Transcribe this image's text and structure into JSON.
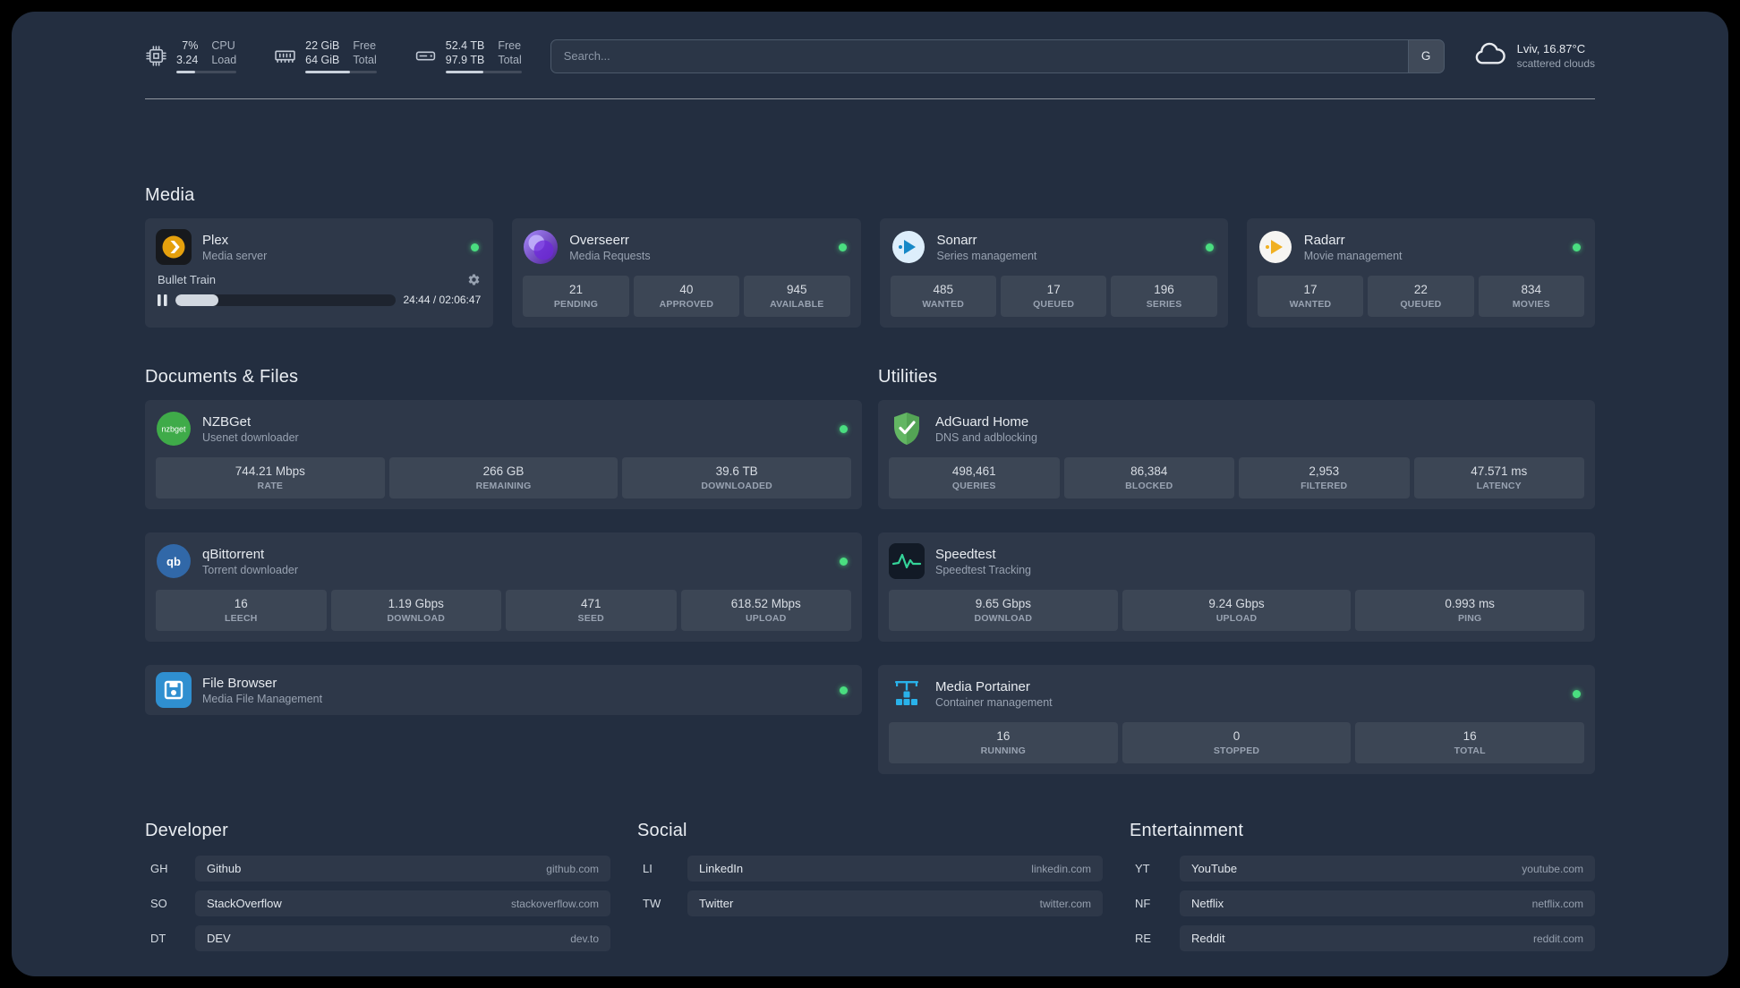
{
  "theme": {
    "background": "#232e40",
    "card": "rgba(255,255,255,0.05)",
    "status_dot_green": "#4ade80",
    "speedtest_line_green": "#34d399",
    "plex_amber": "#e5a00d"
  },
  "topbar": {
    "cpu": {
      "v1": "7%",
      "l1": "CPU",
      "v2": "3.24",
      "l2": "Load",
      "bar_pct": 32
    },
    "memory": {
      "v1": "22 GiB",
      "l1": "Free",
      "v2": "64 GiB",
      "l2": "Total",
      "bar_pct": 62
    },
    "disk": {
      "v1": "52.4 TB",
      "l1": "Free",
      "v2": "97.9 TB",
      "l2": "Total",
      "bar_pct": 50
    },
    "search": {
      "placeholder": "Search...",
      "button": "G"
    },
    "weather": {
      "location": "Lviv, 16.87°C",
      "condition": "scattered clouds"
    }
  },
  "sections": {
    "media": {
      "title": "Media",
      "plex": {
        "name": "Plex",
        "desc": "Media server",
        "now_playing": "Bullet Train",
        "time": "24:44 / 02:06:47",
        "progress_pct": 19.5
      },
      "overseerr": {
        "name": "Overseerr",
        "desc": "Media Requests",
        "stats": [
          {
            "v": "21",
            "l": "PENDING"
          },
          {
            "v": "40",
            "l": "APPROVED"
          },
          {
            "v": "945",
            "l": "AVAILABLE"
          }
        ]
      },
      "sonarr": {
        "name": "Sonarr",
        "desc": "Series management",
        "stats": [
          {
            "v": "485",
            "l": "WANTED"
          },
          {
            "v": "17",
            "l": "QUEUED"
          },
          {
            "v": "196",
            "l": "SERIES"
          }
        ]
      },
      "radarr": {
        "name": "Radarr",
        "desc": "Movie management",
        "stats": [
          {
            "v": "17",
            "l": "WANTED"
          },
          {
            "v": "22",
            "l": "QUEUED"
          },
          {
            "v": "834",
            "l": "MOVIES"
          }
        ]
      }
    },
    "documents": {
      "title": "Documents & Files",
      "nzbget": {
        "name": "NZBGet",
        "desc": "Usenet downloader",
        "stats": [
          {
            "v": "744.21 Mbps",
            "l": "RATE"
          },
          {
            "v": "266 GB",
            "l": "REMAINING"
          },
          {
            "v": "39.6 TB",
            "l": "DOWNLOADED"
          }
        ]
      },
      "qbittorrent": {
        "name": "qBittorrent",
        "desc": "Torrent downloader",
        "stats": [
          {
            "v": "16",
            "l": "LEECH"
          },
          {
            "v": "1.19 Gbps",
            "l": "DOWNLOAD"
          },
          {
            "v": "471",
            "l": "SEED"
          },
          {
            "v": "618.52 Mbps",
            "l": "UPLOAD"
          }
        ]
      },
      "filebrowser": {
        "name": "File Browser",
        "desc": "Media File Management"
      }
    },
    "utilities": {
      "title": "Utilities",
      "adguard": {
        "name": "AdGuard Home",
        "desc": "DNS and adblocking",
        "stats": [
          {
            "v": "498,461",
            "l": "QUERIES"
          },
          {
            "v": "86,384",
            "l": "BLOCKED"
          },
          {
            "v": "2,953",
            "l": "FILTERED"
          },
          {
            "v": "47.571 ms",
            "l": "LATENCY"
          }
        ]
      },
      "speedtest": {
        "name": "Speedtest",
        "desc": "Speedtest Tracking",
        "stats": [
          {
            "v": "9.65 Gbps",
            "l": "DOWNLOAD"
          },
          {
            "v": "9.24 Gbps",
            "l": "UPLOAD"
          },
          {
            "v": "0.993 ms",
            "l": "PING"
          }
        ]
      },
      "portainer": {
        "name": "Media Portainer",
        "desc": "Container management",
        "stats": [
          {
            "v": "16",
            "l": "RUNNING"
          },
          {
            "v": "0",
            "l": "STOPPED"
          },
          {
            "v": "16",
            "l": "TOTAL"
          }
        ]
      }
    }
  },
  "bookmarks": {
    "developer": {
      "title": "Developer",
      "items": [
        {
          "abbr": "GH",
          "name": "Github",
          "url": "github.com"
        },
        {
          "abbr": "SO",
          "name": "StackOverflow",
          "url": "stackoverflow.com"
        },
        {
          "abbr": "DT",
          "name": "DEV",
          "url": "dev.to"
        }
      ]
    },
    "social": {
      "title": "Social",
      "items": [
        {
          "abbr": "LI",
          "name": "LinkedIn",
          "url": "linkedin.com"
        },
        {
          "abbr": "TW",
          "name": "Twitter",
          "url": "twitter.com"
        }
      ]
    },
    "entertainment": {
      "title": "Entertainment",
      "items": [
        {
          "abbr": "YT",
          "name": "YouTube",
          "url": "youtube.com"
        },
        {
          "abbr": "NF",
          "name": "Netflix",
          "url": "netflix.com"
        },
        {
          "abbr": "RE",
          "name": "Reddit",
          "url": "reddit.com"
        }
      ]
    }
  }
}
